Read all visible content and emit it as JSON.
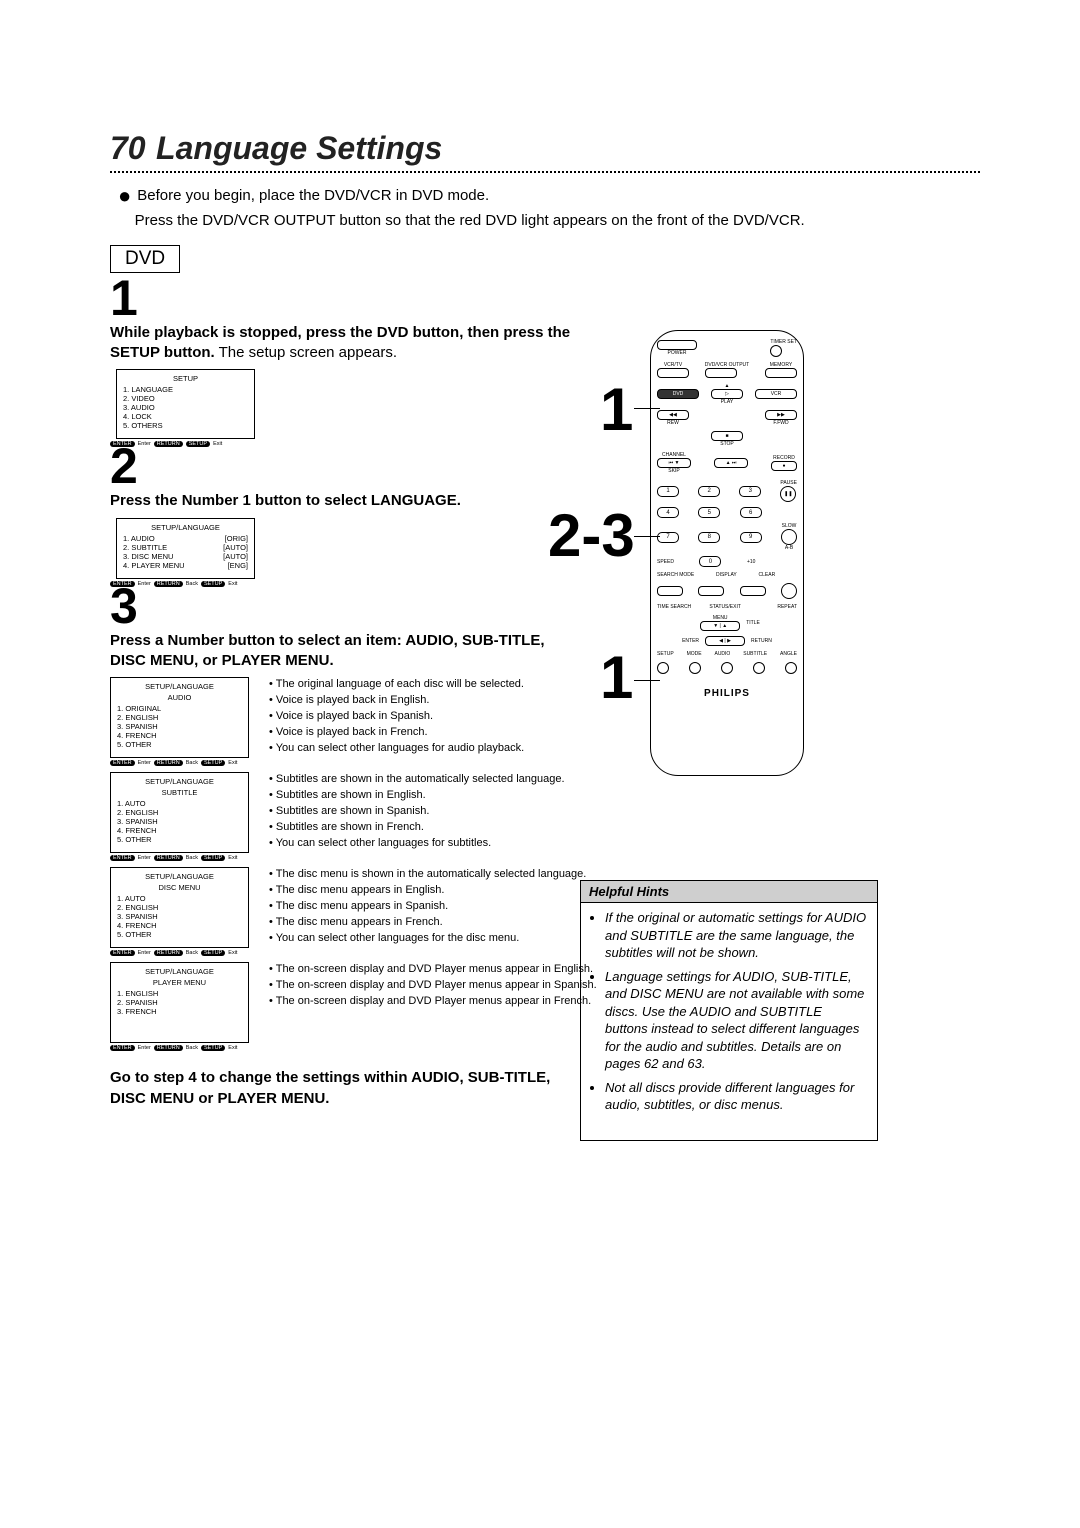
{
  "page_number": "70",
  "page_title": "Language Settings",
  "intro_line1": "Before you begin, place the DVD/VCR in DVD mode.",
  "intro_line2": "Press the DVD/VCR OUTPUT button so that the red DVD light appears on the front of the DVD/VCR.",
  "mode_badge": "DVD",
  "step1_num": "1",
  "step1_bold": "While playback is stopped, press the DVD button, then press the SETUP button.",
  "step1_rest": " The setup screen appears.",
  "setup_main_title": "SETUP",
  "setup_main_items": [
    "1. LANGUAGE",
    "2. VIDEO",
    "3. AUDIO",
    "4. LOCK",
    "5. OTHERS"
  ],
  "footer_enter": "ENTER",
  "footer_enter_t": "Enter",
  "footer_return": "RETURN",
  "footer_setup": "SETUP",
  "footer_back": "Back",
  "footer_exit": "Exit",
  "step2_num": "2",
  "step2_txt": "Press the Number 1 button to select LANGUAGE.",
  "setup_lang_title": "SETUP/LANGUAGE",
  "setup_lang_items": [
    {
      "l": "1. AUDIO",
      "r": "[ORIG]"
    },
    {
      "l": "2. SUBTITLE",
      "r": "[AUTO]"
    },
    {
      "l": "3. DISC MENU",
      "r": "[AUTO]"
    },
    {
      "l": "4. PLAYER MENU",
      "r": "[ENG]"
    }
  ],
  "step3_num": "3",
  "step3_txt": "Press a Number button to select an item: AUDIO, SUB-TITLE, DISC MENU, or PLAYER MENU.",
  "audio_title1": "SETUP/LANGUAGE",
  "audio_title2": "AUDIO",
  "audio_items": [
    "1. ORIGINAL",
    "2. ENGLISH",
    "3. SPANISH",
    "4. FRENCH",
    "5. OTHER"
  ],
  "audio_expl": [
    "The original language of each disc will be selected.",
    "Voice is played back in English.",
    "Voice is played back in Spanish.",
    "Voice is played back in French.",
    "You can select other languages for audio playback."
  ],
  "sub_title1": "SETUP/LANGUAGE",
  "sub_title2": "SUBTITLE",
  "sub_items": [
    "1. AUTO",
    "2. ENGLISH",
    "3. SPANISH",
    "4. FRENCH",
    "5. OTHER"
  ],
  "sub_expl": [
    "Subtitles are shown in the automatically selected language.",
    "Subtitles are shown in English.",
    "Subtitles are shown in Spanish.",
    "Subtitles are shown in French.",
    "You can select other languages for subtitles."
  ],
  "disc_title1": "SETUP/LANGUAGE",
  "disc_title2": "DISC MENU",
  "disc_items": [
    "1. AUTO",
    "2. ENGLISH",
    "3. SPANISH",
    "4. FRENCH",
    "5. OTHER"
  ],
  "disc_expl": [
    "The disc menu is shown in the automatically selected language.",
    "The disc menu appears in English.",
    "The disc menu appears in Spanish.",
    "The disc menu appears in French.",
    "You can select other languages for the disc menu."
  ],
  "pm_title1": "SETUP/LANGUAGE",
  "pm_title2": "PLAYER MENU",
  "pm_items": [
    "1. ENGLISH",
    "2. SPANISH",
    "3. FRENCH"
  ],
  "pm_expl": [
    "The on-screen display and DVD Player menus appear in English.",
    "The on-screen display and DVD Player menus appear in Spanish.",
    "The on-screen display and DVD Player menus appear in French."
  ],
  "goto_txt": "Go to step 4 to change the settings within AUDIO, SUB-TITLE, DISC MENU or PLAYER MENU.",
  "hints_title": "Helpful Hints",
  "hints": [
    "If the original or automatic settings for AUDIO and SUBTITLE are the same language, the subtitles will not be shown.",
    "Language settings for AUDIO, SUB-TITLE, and DISC MENU are not available with some discs. Use the AUDIO and SUBTITLE buttons instead to select different languages for the audio and subtitles. Details are on pages 62 and 63.",
    "Not all discs provide different languages for audio, subtitles, or disc menus."
  ],
  "callouts": {
    "c1": "1",
    "c23": "2-3",
    "c1b": "1"
  },
  "remote": {
    "brand": "PHILIPS",
    "row_top": {
      "power": "POWER",
      "timer": "TIMER SET"
    },
    "row2": {
      "vcrtv": "VCR/TV",
      "dvdvcr": "DVD/VCR OUTPUT",
      "memory": "MEMORY"
    },
    "row3": {
      "dvd": "DVD",
      "vcr": "VCR",
      "play": "PLAY"
    },
    "row4": {
      "rew": "REW",
      "ffwd": "F.FWD"
    },
    "row5": {
      "stop": "STOP"
    },
    "row6": {
      "channel": "CHANNEL",
      "record": "RECORD",
      "skip": "SKIP"
    },
    "pause": "PAUSE",
    "slow": "SLOW",
    "ab": "A-B",
    "speed": "SPEED",
    "plus10": "+10",
    "num0": "0",
    "sm": "SEARCH MODE",
    "display": "DISPLAY",
    "clear": "CLEAR",
    "ts": "TIME SEARCH",
    "status": "STATUS/EXIT",
    "repeat": "REPEAT",
    "menu": "MENU",
    "title": "TITLE",
    "enter": "ENTER",
    "return": "RETURN",
    "bottom": [
      "SETUP",
      "MODE",
      "AUDIO",
      "SUBTITLE",
      "ANGLE"
    ]
  }
}
